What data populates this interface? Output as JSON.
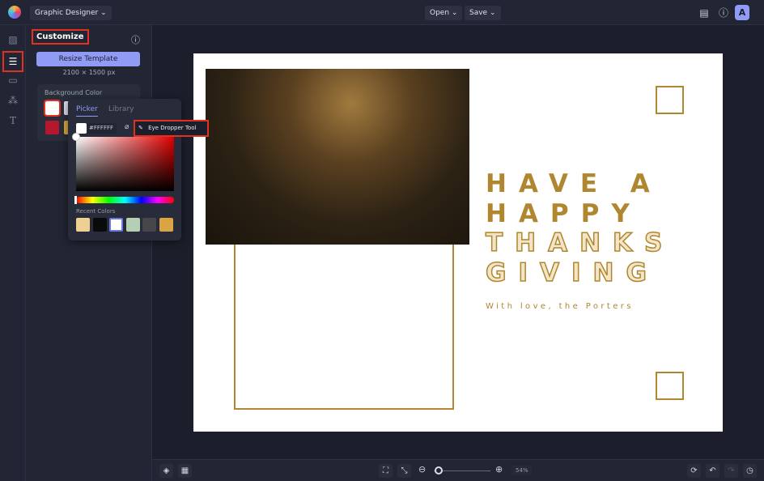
{
  "topbar": {
    "app_name": "Graphic Designer",
    "open_label": "Open",
    "save_label": "Save",
    "avatar_letter": "A"
  },
  "panel": {
    "title": "Customize",
    "resize_label": "Resize Template",
    "dimensions": "2100 × 1500 px",
    "bg_color_label": "Background Color"
  },
  "picker": {
    "tabs": [
      "Picker",
      "Library"
    ],
    "hex_value": "#FFFFFF",
    "eyedropper_tooltip": "Eye Dropper Tool",
    "recent_label": "Recent Colors",
    "recent_colors": [
      "#f0cf95",
      "#0a0a0a",
      "#ffffff",
      "#b5cfb6",
      "#47464a",
      "#d9a441"
    ]
  },
  "bg_swatches": [
    "#ffffff",
    "#b4172e",
    "#d9a441"
  ],
  "design": {
    "line1": "HAVE A",
    "line2": "HAPPY",
    "line3": "THANKS",
    "line4": "GIVING",
    "tagline": "With love, the Porters",
    "accent": "#b0862f"
  },
  "bottom": {
    "zoom": "54%",
    "zoom_fraction": 0.05
  }
}
